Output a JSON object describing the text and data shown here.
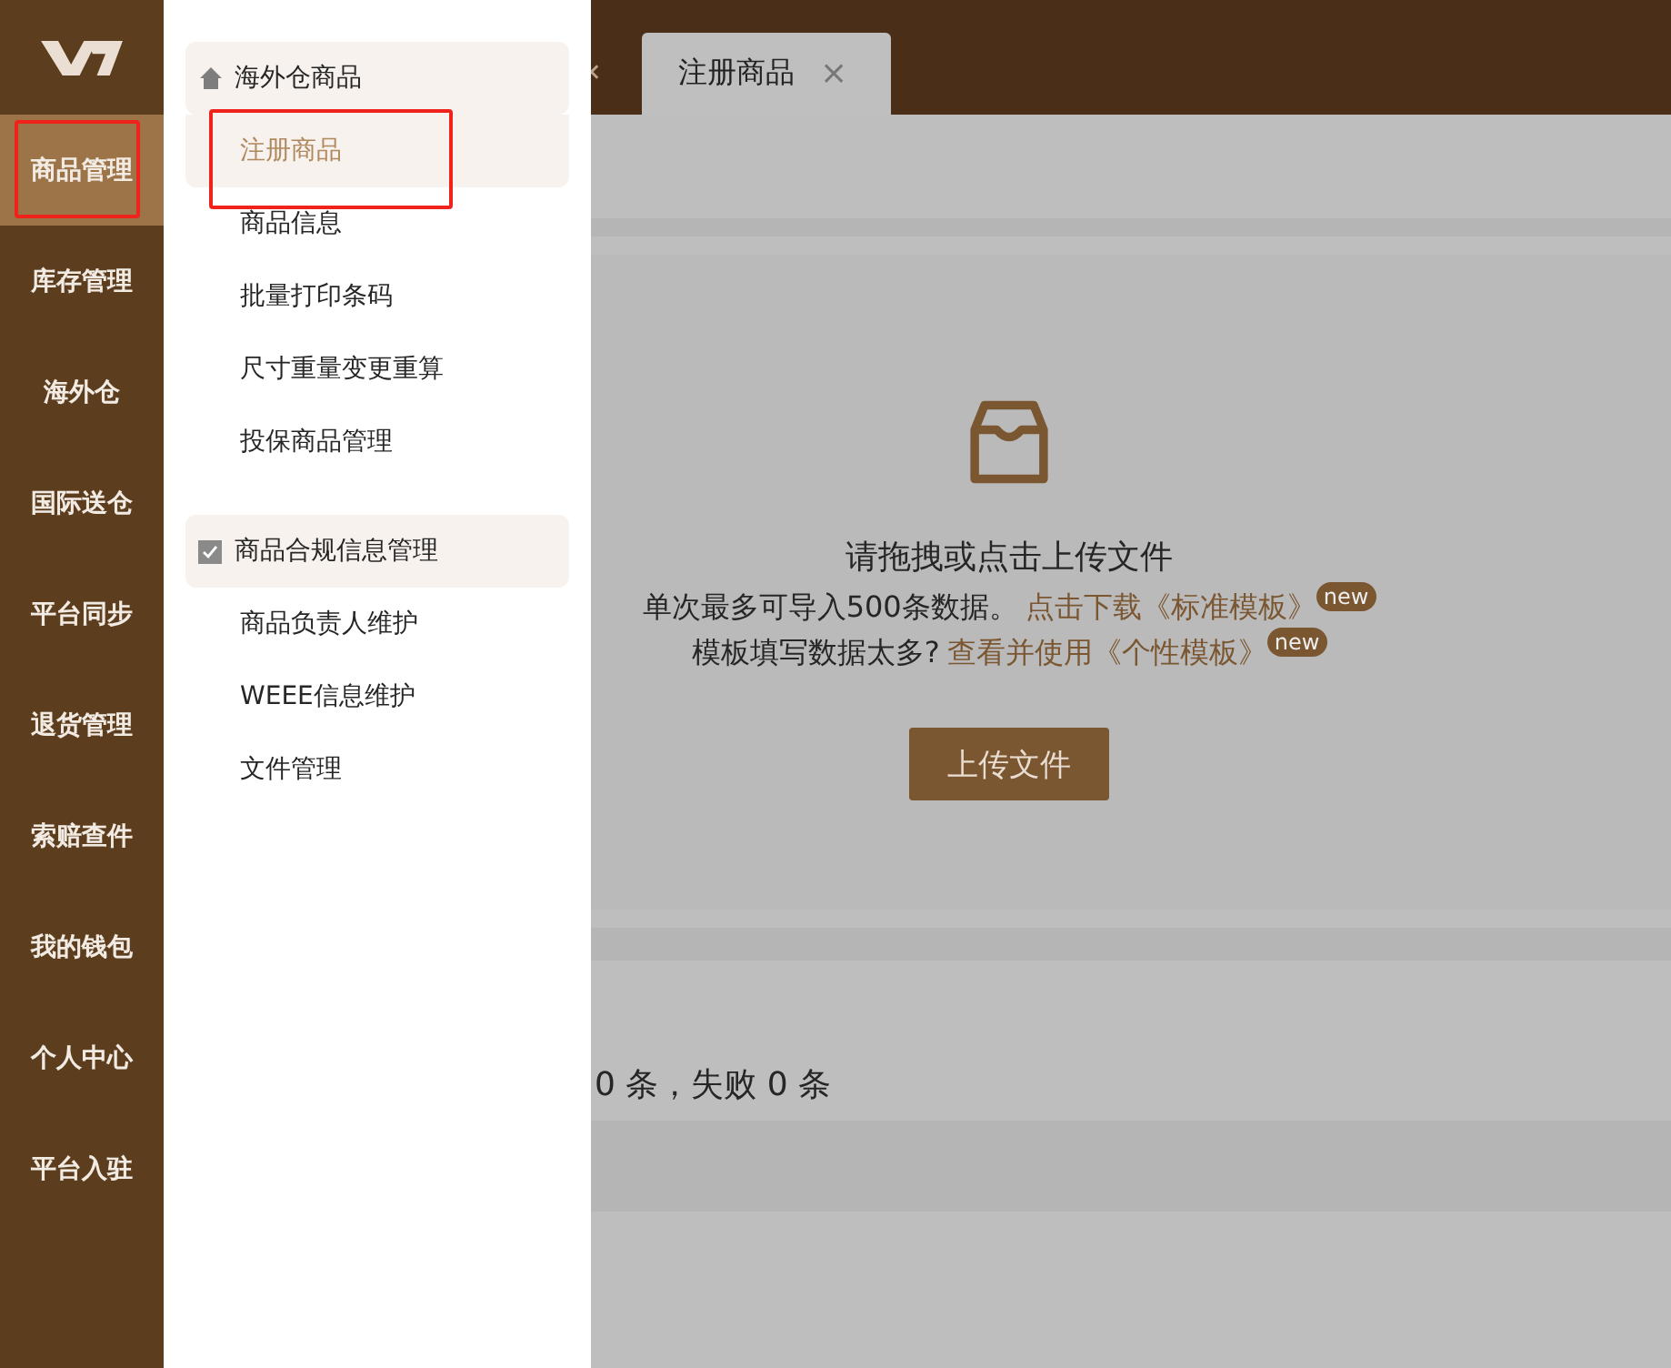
{
  "rail": {
    "items": [
      {
        "label": "商品管理",
        "selected": true,
        "highlighted": true
      },
      {
        "label": "库存管理",
        "selected": false,
        "highlighted": false
      },
      {
        "label": "海外仓",
        "selected": false,
        "highlighted": false
      },
      {
        "label": "国际送仓",
        "selected": false,
        "highlighted": false
      },
      {
        "label": "平台同步",
        "selected": false,
        "highlighted": false
      },
      {
        "label": "退货管理",
        "selected": false,
        "highlighted": false
      },
      {
        "label": "索赔查件",
        "selected": false,
        "highlighted": false
      },
      {
        "label": "我的钱包",
        "selected": false,
        "highlighted": false
      },
      {
        "label": "个人中心",
        "selected": false,
        "highlighted": false
      },
      {
        "label": "平台入驻",
        "selected": false,
        "highlighted": false
      }
    ]
  },
  "menu": {
    "groups": [
      {
        "title": "海外仓商品",
        "kind": "home",
        "items": [
          {
            "label": "注册商品",
            "selected": true,
            "highlighted": true
          },
          {
            "label": "商品信息",
            "selected": false,
            "highlighted": false
          },
          {
            "label": "批量打印条码",
            "selected": false,
            "highlighted": false
          },
          {
            "label": "尺寸重量变更重算",
            "selected": false,
            "highlighted": false
          },
          {
            "label": "投保商品管理",
            "selected": false,
            "highlighted": false
          }
        ]
      },
      {
        "title": "商品合规信息管理",
        "kind": "check",
        "items": [
          {
            "label": "商品负责人维护",
            "selected": false,
            "highlighted": false
          },
          {
            "label": "WEEE信息维护",
            "selected": false,
            "highlighted": false
          },
          {
            "label": "文件管理",
            "selected": false,
            "highlighted": false
          }
        ]
      }
    ]
  },
  "tabs": [
    {
      "label": "注册商品",
      "selected": true,
      "close": "×"
    }
  ],
  "upload": {
    "title": "请拖拽或点击上传文件",
    "lines": [
      {
        "text": "单次最多可导入500条数据。",
        "link": "点击下载《标准模板》",
        "badge": "new"
      },
      {
        "text": "模板填写数据太多?",
        "link": "查看并使用《个性模板》",
        "badge": "new"
      }
    ],
    "button": "上传文件"
  },
  "result": "0 条，失败 0 条"
}
